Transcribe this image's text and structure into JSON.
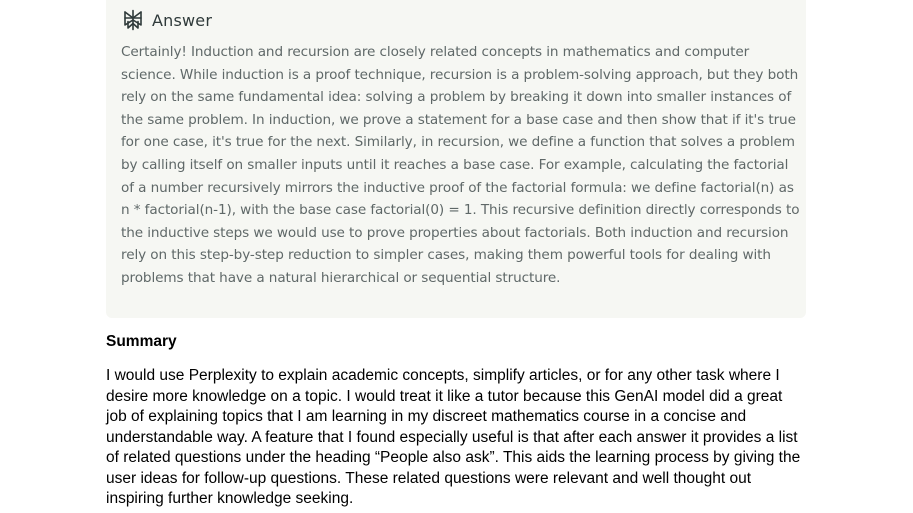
{
  "answer": {
    "icon": "perplexity-answer-icon",
    "title": "Answer",
    "body": "Certainly! Induction and recursion are closely related concepts in mathematics and computer science. While induction is a proof technique, recursion is a problem-solving approach, but they both rely on the same fundamental idea: solving a problem by breaking it down into smaller instances of the same problem. In induction, we prove a statement for a base case and then show that if it's true for one case, it's true for the next. Similarly, in recursion, we define a function that solves a problem by calling itself on smaller inputs until it reaches a base case. For example, calculating the factorial of a number recursively mirrors the inductive proof of the factorial formula: we define factorial(n) as n * factorial(n-1), with the base case factorial(0) = 1. This recursive definition directly corresponds to the inductive steps we would use to prove properties about factorials. Both induction and recursion rely on this step-by-step reduction to simpler cases, making them powerful tools for dealing with problems that have a natural hierarchical or sequential structure."
  },
  "summary": {
    "heading": "Summary",
    "body": "I would use Perplexity to explain academic concepts, simplify articles, or for any other task where I desire more knowledge on a topic. I would treat it like a tutor because this GenAI model did a great job of explaining topics that I am learning in my discreet mathematics course in a concise and understandable way. A feature that I found especially useful is that after each answer it provides a list of related questions under the heading “People also ask”. This aids the learning process by giving the user ideas for follow-up questions. These related questions were relevant and well thought out inspiring further knowledge seeking."
  },
  "colors": {
    "card_background": "#f6f7f3",
    "answer_text": "#5f6868",
    "answer_title": "#2f3a3a"
  }
}
